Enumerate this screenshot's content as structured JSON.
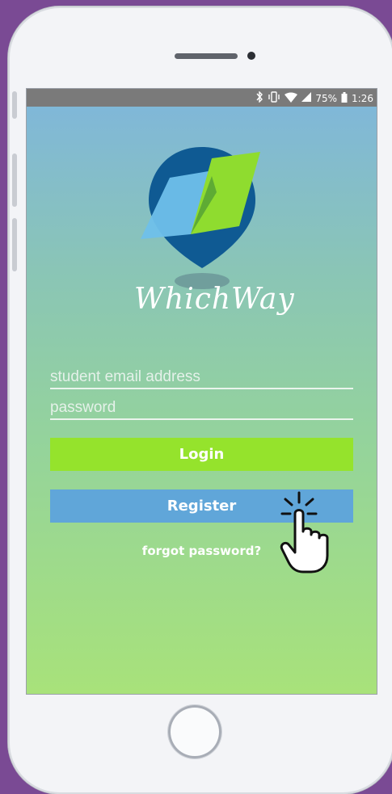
{
  "status_bar": {
    "battery_percent": "75%",
    "time": "1:26",
    "icons": [
      "bluetooth-icon",
      "vibrate-icon",
      "wifi-icon",
      "signal-icon",
      "battery-icon"
    ]
  },
  "app": {
    "name": "WhichWay",
    "colors": {
      "brand_blue": "#0f5a93",
      "brand_light_blue": "#6fc0ea",
      "brand_green": "#8fdc2f"
    }
  },
  "login_form": {
    "email_placeholder": "student email address",
    "password_placeholder": "password",
    "login_label": "Login",
    "register_label": "Register",
    "forgot_label": "forgot password?"
  },
  "accent_colors": {
    "login_button": "#95e32c",
    "register_button": "#60a6d9"
  }
}
